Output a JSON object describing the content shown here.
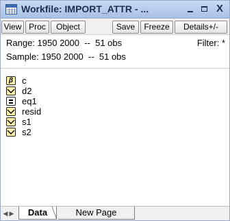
{
  "window": {
    "title": "Workfile: IMPORT_ATTR - ...",
    "controls": {
      "close_label": "X"
    },
    "icon": "workfile-icon"
  },
  "toolbar": {
    "view_label": "View",
    "proc_label": "Proc",
    "object_label": "Object",
    "save_label": "Save",
    "freeze_label": "Freeze",
    "details_label": "Details+/-"
  },
  "info": {
    "range_label": "Range:",
    "range_value": "1950 2000  --  51 obs",
    "filter_label": "Filter: *",
    "sample_label": "Sample:",
    "sample_value": "1950 2000  --  51 obs"
  },
  "objects": [
    {
      "name": "c",
      "icon": "coefficient-icon"
    },
    {
      "name": "d2",
      "icon": "series-icon"
    },
    {
      "name": "eq1",
      "icon": "equation-icon"
    },
    {
      "name": "resid",
      "icon": "series-icon"
    },
    {
      "name": "s1",
      "icon": "series-icon"
    },
    {
      "name": "s2",
      "icon": "series-icon"
    }
  ],
  "tabs": {
    "data_label": "Data",
    "new_page_label": "New Page"
  },
  "colors": {
    "titlebar": "#b8cdee",
    "icon_fill": "#fff1a8"
  }
}
